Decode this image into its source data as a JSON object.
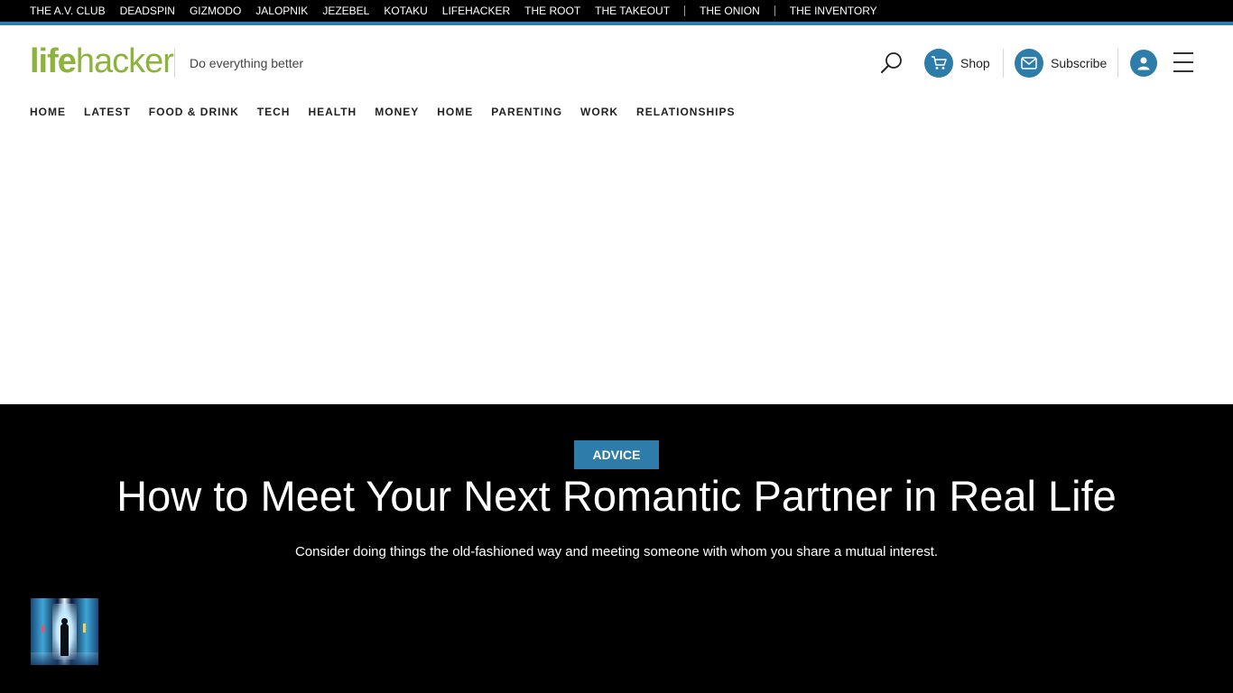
{
  "network": {
    "links": [
      "THE A.V. CLUB",
      "DEADSPIN",
      "GIZMODO",
      "JALOPNIK",
      "JEZEBEL",
      "KOTAKU",
      "LIFEHACKER",
      "THE ROOT",
      "THE TAKEOUT"
    ],
    "links_after_sep1": [
      "THE ONION"
    ],
    "links_after_sep2": [
      "THE INVENTORY"
    ]
  },
  "header": {
    "logo_life": "life",
    "logo_hacker": "hacker",
    "tagline": "Do everything better",
    "shop_label": "Shop",
    "subscribe_label": "Subscribe",
    "icons": {
      "search": "search-icon",
      "shop": "cart-icon",
      "subscribe": "mail-icon",
      "account": "user-icon",
      "menu": "hamburger-icon"
    }
  },
  "nav": {
    "items": [
      "HOME",
      "LATEST",
      "FOOD & DRINK",
      "TECH",
      "HEALTH",
      "MONEY",
      "HOME",
      "PARENTING",
      "WORK",
      "RELATIONSHIPS"
    ]
  },
  "hero": {
    "category": "ADVICE",
    "headline": "How to Meet Your Next Romantic Partner in Real Life",
    "dek": "Consider doing things the old-fashioned way and meeting someone with whom you share a mutual interest."
  },
  "colors": {
    "accent": "#2d7ca9",
    "brand_green": "#8cb43d",
    "hero_bg": "#000000"
  }
}
